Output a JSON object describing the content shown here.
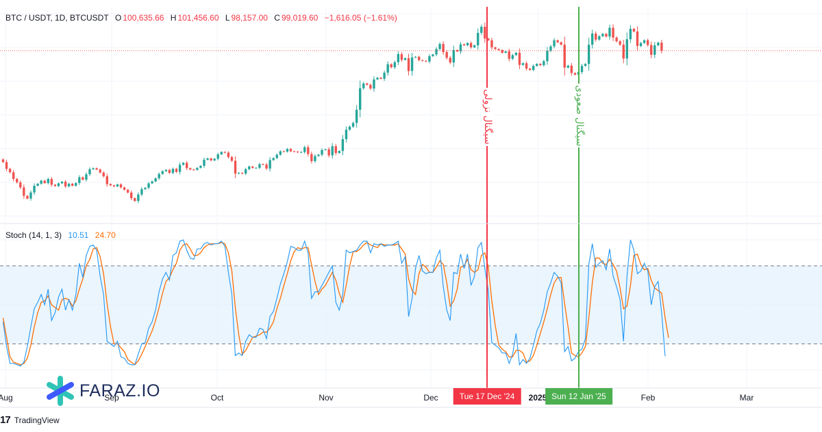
{
  "header": {
    "symbol": "BTC / USDT, 1D, BTCUSDT",
    "o_label": "O",
    "o_value": "100,635.66",
    "h_label": "H",
    "h_value": "101,456.60",
    "l_label": "L",
    "l_value": "98,157.00",
    "c_label": "C",
    "c_value": "99,019.60",
    "change": "−1,616.05 (−1.61%)"
  },
  "stoch": {
    "label": "Stoch (14, 1, 3)",
    "k_value": "10.51",
    "d_value": "24.70"
  },
  "x_labels": [
    "Aug",
    "Sep",
    "Oct",
    "Nov",
    "Dec",
    "2025",
    "Feb",
    "Mar"
  ],
  "markers": [
    {
      "badge": "Tue 17 Dec '24",
      "label": "سیگنال نزولی",
      "color": "#f23645"
    },
    {
      "badge": "Sun 12 Jan '25",
      "label": "سیگنال صعودی",
      "color": "#4caf50"
    }
  ],
  "logo": {
    "text": "FARAZ.IO"
  },
  "watermark": {
    "text": "TradingView"
  },
  "colors": {
    "up": "#26a69a",
    "down": "#ef5350",
    "k_line": "#2196f3",
    "d_line": "#ff6d00",
    "band": "#e3f2fd"
  },
  "chart_data": [
    {
      "type": "candlestick",
      "title": "BTC / USDT, 1D, BTCUSDT",
      "x_start": "2024-07-28",
      "x_step": "1 day",
      "ylim": [
        48000,
        112000
      ],
      "current_price": 99019.6,
      "close": [
        66000,
        64000,
        63000,
        61000,
        60000,
        58500,
        56000,
        55200,
        57000,
        59000,
        59600,
        60500,
        59800,
        61000,
        59300,
        58900,
        59700,
        60200,
        58800,
        59600,
        59000,
        59800,
        61500,
        60800,
        62400,
        63900,
        64200,
        63800,
        62900,
        61800,
        59500,
        59100,
        58800,
        59400,
        58500,
        57800,
        57000,
        55300,
        54500,
        56400,
        58000,
        58400,
        59700,
        60300,
        61200,
        62500,
        63300,
        63700,
        62800,
        64000,
        63100,
        65200,
        65800,
        64200,
        63800,
        63700,
        64300,
        64900,
        66700,
        67100,
        66500,
        67000,
        68300,
        69000,
        68800,
        67500,
        66400,
        62600,
        62800,
        62600,
        63900,
        64700,
        64300,
        64300,
        65400,
        65300,
        64100,
        66600,
        67200,
        68200,
        69200,
        69100,
        69900,
        69200,
        69100,
        68900,
        69000,
        70400,
        68400,
        66300,
        67800,
        68200,
        69600,
        69800,
        68000,
        70700,
        68700,
        69300,
        72800,
        75600,
        76500,
        77600,
        81500,
        87900,
        89300,
        88900,
        87800,
        90500,
        91000,
        90700,
        92500,
        95000,
        94100,
        95600,
        98000,
        96300,
        96800,
        93000,
        97000,
        97200,
        96200,
        96000,
        95800,
        97400,
        97900,
        99500,
        101000,
        98600,
        96900,
        95500,
        99200,
        98800,
        100900,
        100600,
        101300,
        100000,
        100600,
        104300,
        106100,
        102600,
        102100,
        100000,
        99500,
        99200,
        98400,
        98800,
        96600,
        97700,
        98400,
        94800,
        95300,
        93700,
        93300,
        94500,
        95100,
        94700,
        95900,
        99000,
        100300,
        102100,
        101500,
        100800,
        94000,
        94600,
        92400,
        91900,
        92700,
        94500,
        95100,
        100800,
        104100,
        102300,
        103300,
        104000,
        103200,
        105800,
        102900,
        101800,
        100800,
        96700,
        102400,
        105500,
        104700,
        100400,
        101300,
        102100,
        100700,
        97800,
        100600,
        101400,
        99019.6
      ]
    },
    {
      "type": "line",
      "title": "Stoch (14, 1, 3)",
      "ylim": [
        -14,
        112
      ],
      "bands": [
        20,
        80
      ],
      "series": [
        {
          "name": "%K",
          "values": [
            37,
            18,
            5,
            5,
            4,
            3,
            6,
            18,
            33,
            47,
            52,
            58,
            50,
            62,
            38,
            44,
            56,
            62,
            46,
            54,
            46,
            58,
            82,
            71,
            88,
            95,
            96,
            92,
            72,
            58,
            22,
            20,
            18,
            22,
            10,
            9,
            5,
            4,
            4,
            12,
            20,
            21,
            32,
            37,
            46,
            60,
            70,
            75,
            69,
            88,
            90,
            99,
            100,
            92,
            86,
            85,
            93,
            93,
            97,
            98,
            96,
            97,
            97,
            99,
            95,
            75,
            58,
            11,
            13,
            11,
            22,
            27,
            25,
            25,
            32,
            31,
            24,
            41,
            45,
            55,
            66,
            74,
            83,
            95,
            94,
            92,
            92,
            99,
            90,
            55,
            60,
            60,
            65,
            70,
            75,
            80,
            52,
            46,
            58,
            92,
            90,
            91,
            92,
            96,
            99,
            99,
            90,
            97,
            96,
            97,
            95,
            96,
            96,
            97,
            99,
            82,
            87,
            41,
            55,
            78,
            88,
            76,
            74,
            75,
            75,
            86,
            92,
            64,
            46,
            38,
            75,
            74,
            89,
            78,
            89,
            65,
            72,
            94,
            98,
            78,
            61,
            21,
            19,
            17,
            13,
            13,
            5,
            12,
            28,
            4,
            8,
            5,
            9,
            19,
            30,
            36,
            46,
            60,
            67,
            75,
            72,
            67,
            14,
            18,
            7,
            9,
            14,
            16,
            24,
            81,
            97,
            79,
            82,
            84,
            77,
            93,
            72,
            64,
            54,
            22,
            72,
            100,
            92,
            74,
            76,
            82,
            76,
            50,
            64,
            68,
            44,
            10.51
          ]
        },
        {
          "name": "%D",
          "values": [
            40,
            25,
            10,
            6,
            5,
            4,
            5,
            9,
            19,
            33,
            44,
            52,
            53,
            57,
            50,
            48,
            46,
            54,
            55,
            54,
            49,
            53,
            62,
            70,
            80,
            85,
            93,
            94,
            87,
            74,
            51,
            33,
            20,
            20,
            17,
            14,
            8,
            6,
            4,
            7,
            12,
            18,
            24,
            30,
            38,
            48,
            59,
            68,
            71,
            77,
            82,
            92,
            96,
            97,
            93,
            88,
            88,
            90,
            94,
            96,
            97,
            97,
            97,
            98,
            97,
            90,
            76,
            48,
            27,
            12,
            15,
            20,
            25,
            26,
            27,
            29,
            29,
            32,
            37,
            47,
            55,
            65,
            74,
            84,
            91,
            94,
            93,
            94,
            94,
            81,
            68,
            58,
            62,
            65,
            70,
            75,
            69,
            59,
            52,
            65,
            80,
            91,
            91,
            93,
            96,
            98,
            96,
            95,
            94,
            97,
            96,
            96,
            96,
            96,
            97,
            93,
            89,
            70,
            61,
            58,
            74,
            81,
            79,
            75,
            75,
            79,
            84,
            81,
            67,
            49,
            53,
            62,
            79,
            80,
            85,
            77,
            75,
            77,
            88,
            90,
            79,
            53,
            34,
            19,
            16,
            14,
            10,
            10,
            15,
            15,
            13,
            6,
            7,
            11,
            19,
            28,
            37,
            47,
            58,
            67,
            71,
            71,
            51,
            33,
            13,
            11,
            10,
            13,
            18,
            40,
            67,
            86,
            86,
            82,
            81,
            85,
            81,
            76,
            63,
            47,
            49,
            65,
            88,
            89,
            81,
            77,
            78,
            69,
            63,
            61,
            59,
            40,
            24.7
          ]
        }
      ]
    }
  ]
}
